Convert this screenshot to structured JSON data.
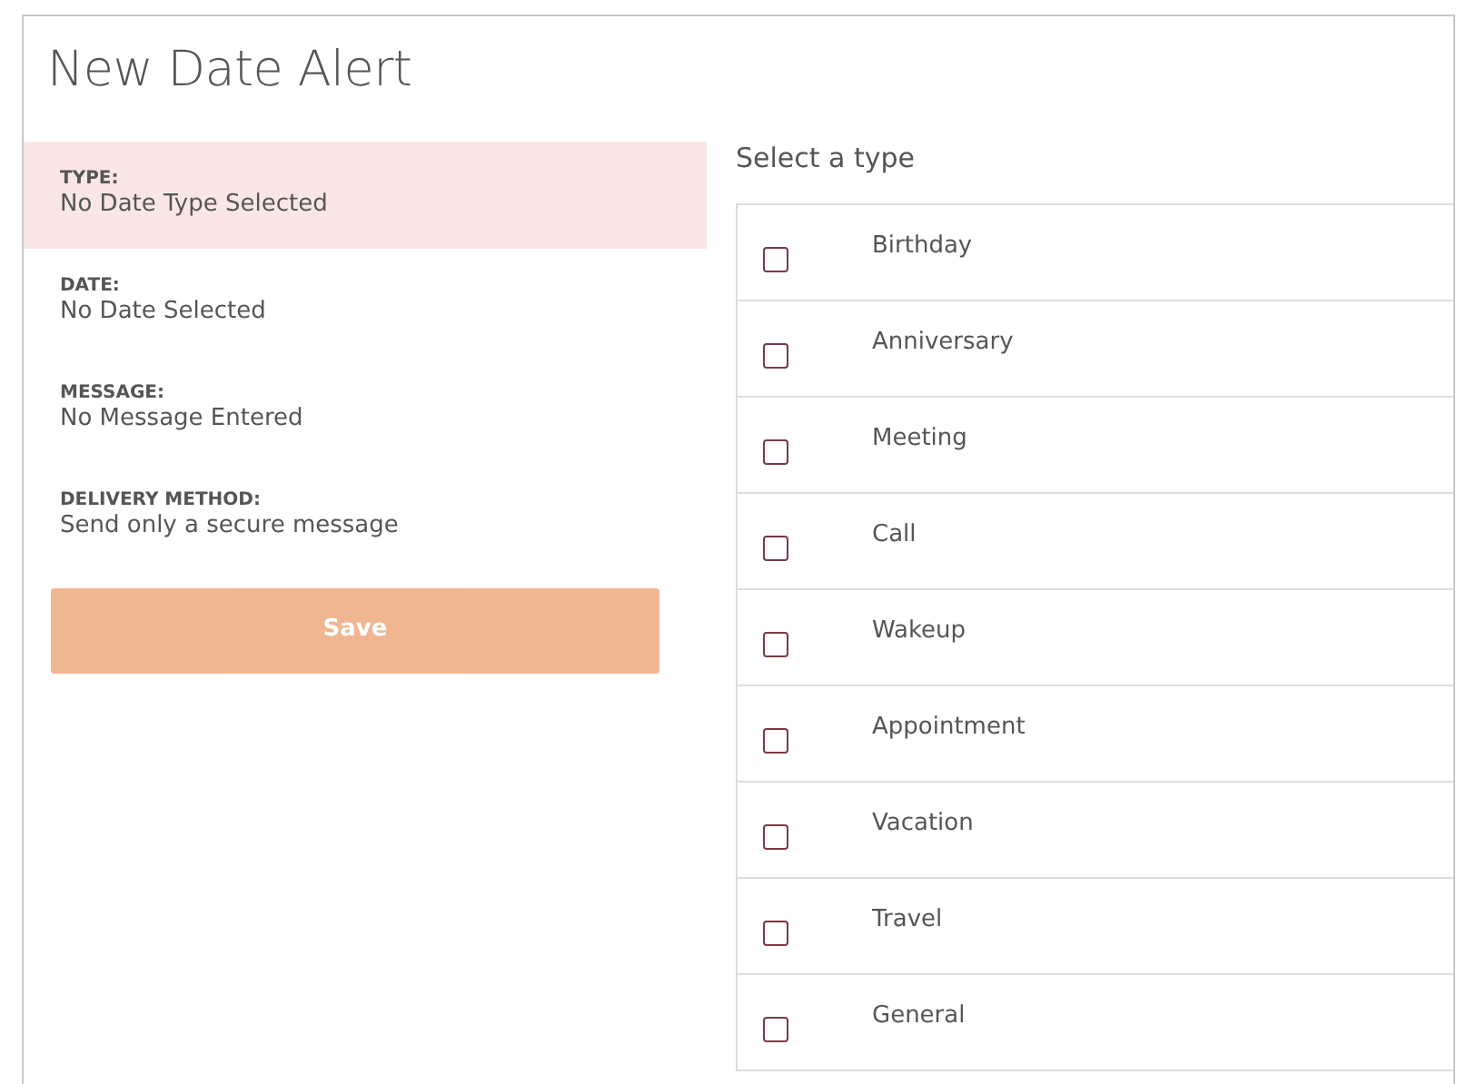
{
  "title": "New Date Alert",
  "summary": [
    {
      "label": "TYPE:",
      "value": "No Date Type Selected",
      "active": true
    },
    {
      "label": "DATE:",
      "value": "No Date Selected",
      "active": false
    },
    {
      "label": "MESSAGE:",
      "value": "No Message Entered",
      "active": false
    },
    {
      "label": "DELIVERY METHOD:",
      "value": "Send only a secure message",
      "active": false
    }
  ],
  "save_button": {
    "label": "Save",
    "disabled": true
  },
  "type_list": {
    "heading": "Select a type",
    "items": [
      {
        "label": "Birthday",
        "checked": false
      },
      {
        "label": "Anniversary",
        "checked": false
      },
      {
        "label": "Meeting",
        "checked": false
      },
      {
        "label": "Call",
        "checked": false
      },
      {
        "label": "Wakeup",
        "checked": false
      },
      {
        "label": "Appointment",
        "checked": false
      },
      {
        "label": "Vacation",
        "checked": false
      },
      {
        "label": "Travel",
        "checked": false
      },
      {
        "label": "General",
        "checked": false
      }
    ]
  }
}
